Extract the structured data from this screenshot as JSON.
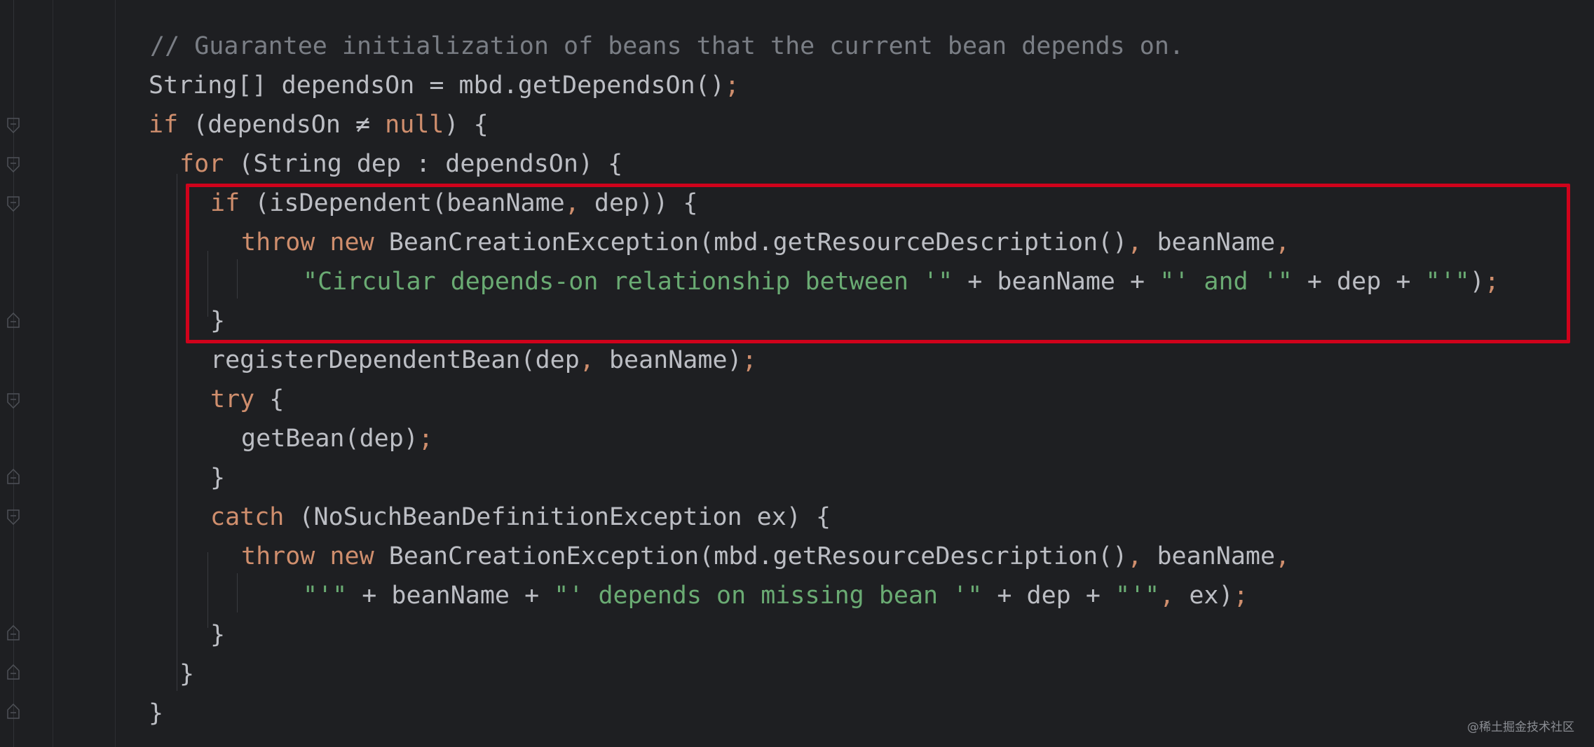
{
  "editor": {
    "lines": [
      {
        "tokens": [
          {
            "t": "// Guarantee initialization of beans that the current bean depends on.",
            "c": "cmt"
          }
        ]
      },
      {
        "tokens": [
          {
            "t": "String[] dependsOn = mbd.getDependsOn()",
            "c": "plain"
          },
          {
            "t": ";",
            "c": "punc-semi"
          }
        ]
      },
      {
        "tokens": [
          {
            "t": "if",
            "c": "kw"
          },
          {
            "t": " (dependsOn ≠ ",
            "c": "plain"
          },
          {
            "t": "null",
            "c": "kw"
          },
          {
            "t": ") {",
            "c": "plain"
          }
        ]
      },
      {
        "tokens": [
          {
            "t": "for",
            "c": "kw"
          },
          {
            "t": " (String dep : dependsOn) {",
            "c": "plain"
          }
        ]
      },
      {
        "tokens": [
          {
            "t": "if",
            "c": "kw"
          },
          {
            "t": " (isDependent(beanName",
            "c": "plain"
          },
          {
            "t": ",",
            "c": "punc-semi"
          },
          {
            "t": " dep)) {",
            "c": "plain"
          }
        ]
      },
      {
        "tokens": [
          {
            "t": "throw",
            "c": "kw"
          },
          {
            "t": " ",
            "c": "plain"
          },
          {
            "t": "new",
            "c": "kw"
          },
          {
            "t": " BeanCreationException(mbd.getResourceDescription()",
            "c": "plain"
          },
          {
            "t": ",",
            "c": "punc-semi"
          },
          {
            "t": " beanName",
            "c": "plain"
          },
          {
            "t": ",",
            "c": "punc-semi"
          }
        ]
      },
      {
        "tokens": [
          {
            "t": "\"Circular depends-on relationship between '\"",
            "c": "str"
          },
          {
            "t": " + beanName + ",
            "c": "plain"
          },
          {
            "t": "\"' and '\"",
            "c": "str"
          },
          {
            "t": " + dep + ",
            "c": "plain"
          },
          {
            "t": "\"'\"",
            "c": "str"
          },
          {
            "t": ")",
            "c": "plain"
          },
          {
            "t": ";",
            "c": "punc-semi"
          }
        ]
      },
      {
        "tokens": [
          {
            "t": "}",
            "c": "plain"
          }
        ]
      },
      {
        "tokens": [
          {
            "t": "registerDependentBean(dep",
            "c": "plain"
          },
          {
            "t": ",",
            "c": "punc-semi"
          },
          {
            "t": " beanName)",
            "c": "plain"
          },
          {
            "t": ";",
            "c": "punc-semi"
          }
        ]
      },
      {
        "tokens": [
          {
            "t": "try",
            "c": "kw"
          },
          {
            "t": " {",
            "c": "plain"
          }
        ]
      },
      {
        "tokens": [
          {
            "t": "getBean(dep)",
            "c": "plain"
          },
          {
            "t": ";",
            "c": "punc-semi"
          }
        ]
      },
      {
        "tokens": [
          {
            "t": "}",
            "c": "plain"
          }
        ]
      },
      {
        "tokens": [
          {
            "t": "catch",
            "c": "kw"
          },
          {
            "t": " (NoSuchBeanDefinitionException ex) {",
            "c": "plain"
          }
        ]
      },
      {
        "tokens": [
          {
            "t": "throw",
            "c": "kw"
          },
          {
            "t": " ",
            "c": "plain"
          },
          {
            "t": "new",
            "c": "kw"
          },
          {
            "t": " BeanCreationException(mbd.getResourceDescription()",
            "c": "plain"
          },
          {
            "t": ",",
            "c": "punc-semi"
          },
          {
            "t": " beanName",
            "c": "plain"
          },
          {
            "t": ",",
            "c": "punc-semi"
          }
        ]
      },
      {
        "tokens": [
          {
            "t": "\"'\"",
            "c": "str"
          },
          {
            "t": " + beanName + ",
            "c": "plain"
          },
          {
            "t": "\"' depends on missing bean '\"",
            "c": "str"
          },
          {
            "t": " + dep + ",
            "c": "plain"
          },
          {
            "t": "\"'\"",
            "c": "str"
          },
          {
            "t": ",",
            "c": "punc-semi"
          },
          {
            "t": " ex)",
            "c": "plain"
          },
          {
            "t": ";",
            "c": "punc-semi"
          }
        ]
      },
      {
        "tokens": [
          {
            "t": "}",
            "c": "plain"
          }
        ]
      },
      {
        "tokens": [
          {
            "t": "}",
            "c": "plain"
          }
        ]
      },
      {
        "tokens": [
          {
            "t": "}",
            "c": "plain"
          }
        ]
      }
    ]
  },
  "watermark": "@稀土掘金技术社区",
  "colors": {
    "background": "#1e1f22",
    "keyword": "#cf8e6d",
    "string": "#6aab73",
    "comment": "#7a7e85",
    "text": "#bcbec4",
    "highlight_border": "#d0021b"
  }
}
